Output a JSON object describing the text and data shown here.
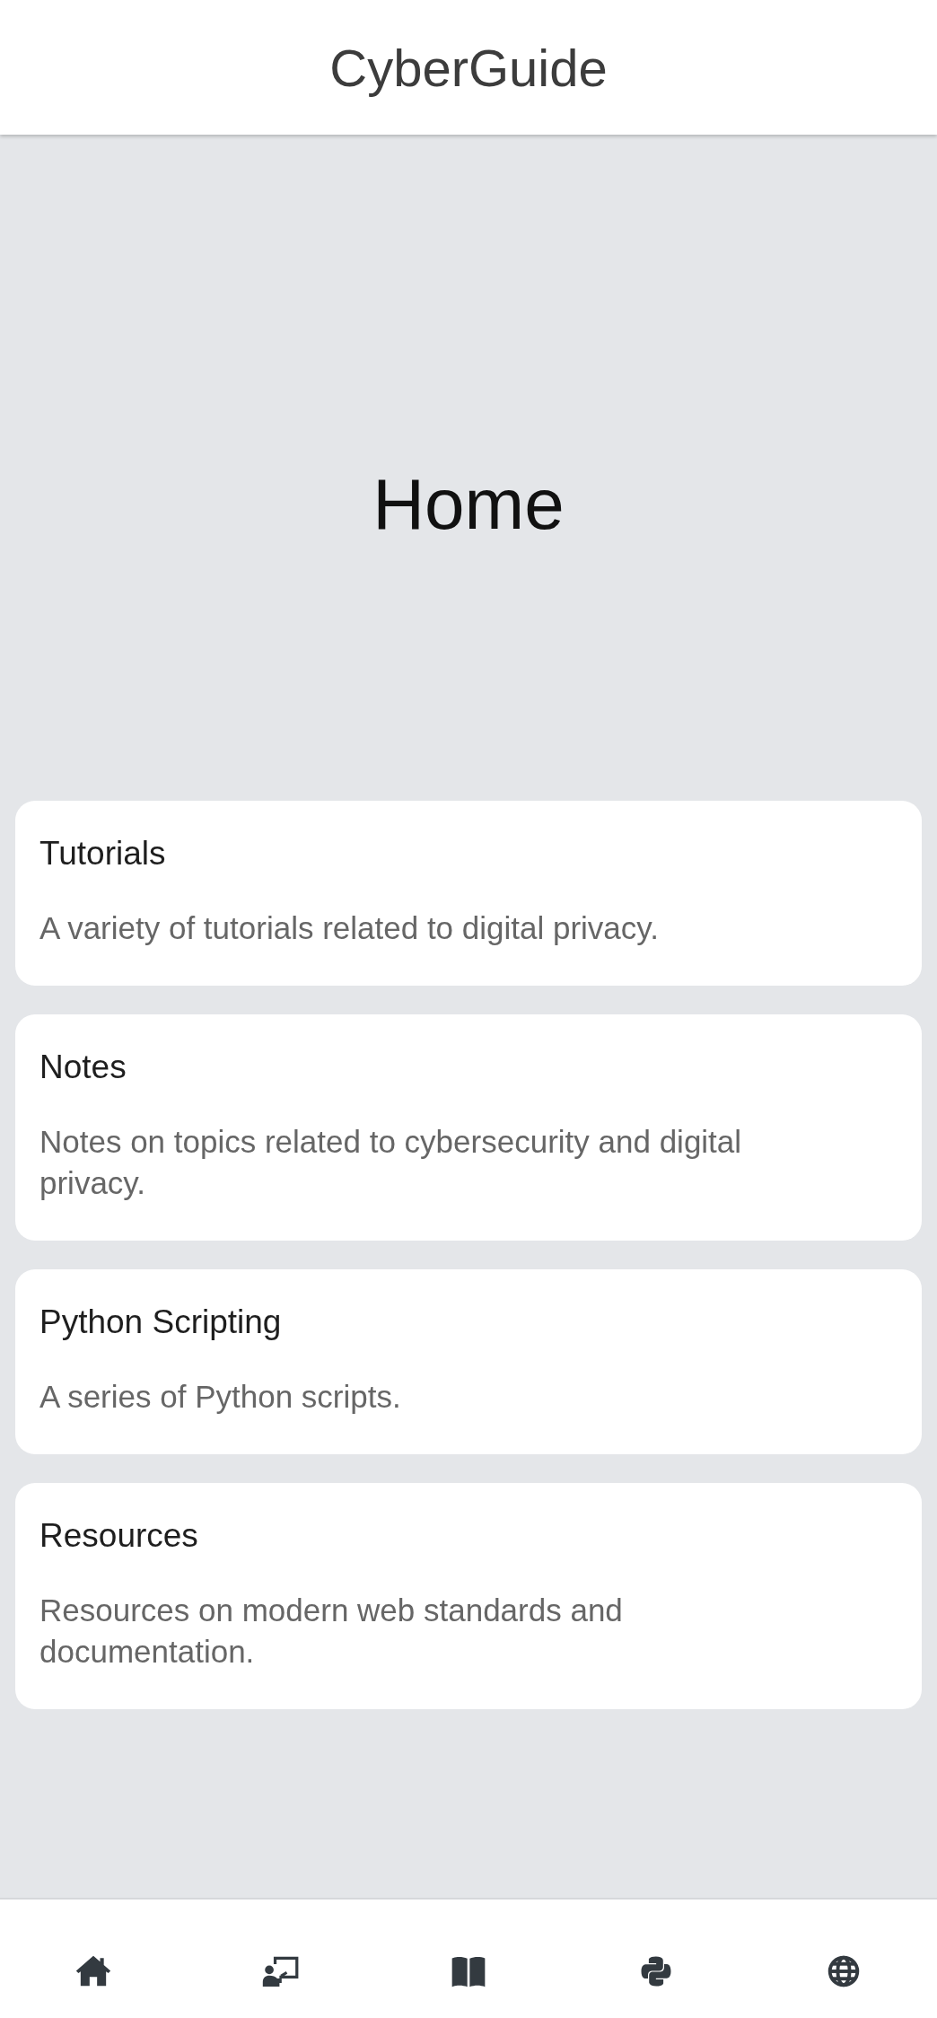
{
  "app_bar": {
    "title": "CyberGuide"
  },
  "page": {
    "heading": "Home"
  },
  "cards": [
    {
      "title": "Tutorials",
      "description": "A variety of tutorials related to digital privacy."
    },
    {
      "title": "Notes",
      "description": "Notes on topics related to cybersecurity and digital privacy."
    },
    {
      "title": "Python Scripting",
      "description": "A series of Python scripts."
    },
    {
      "title": "Resources",
      "description": "Resources on modern web standards and documentation."
    }
  ],
  "bottom_nav": {
    "items": [
      {
        "kind": "home"
      },
      {
        "kind": "presentation"
      },
      {
        "kind": "book"
      },
      {
        "kind": "python"
      },
      {
        "kind": "globe"
      }
    ]
  }
}
